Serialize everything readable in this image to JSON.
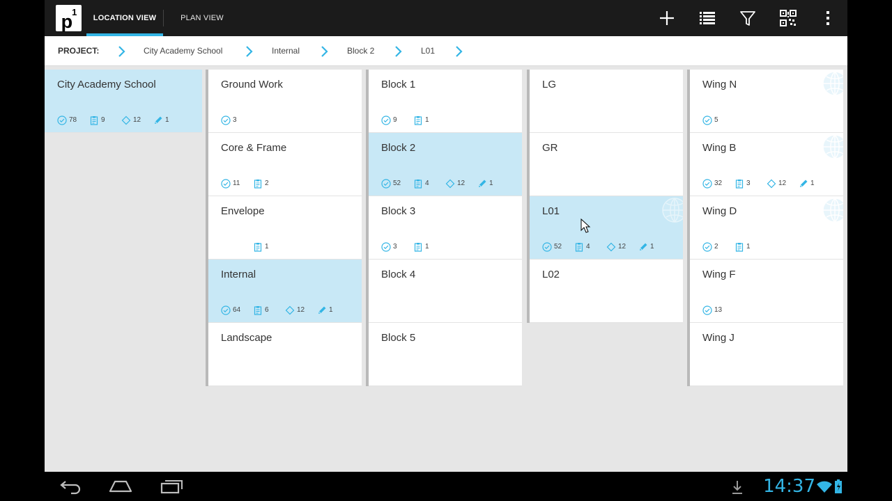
{
  "app": {
    "logo_text": "p",
    "logo_sup": "1",
    "tabs": [
      {
        "label": "LOCATION VIEW"
      },
      {
        "label": "PLAN VIEW"
      }
    ],
    "actions": [
      "add-icon",
      "list-icon",
      "filter-icon",
      "qr-code-icon",
      "overflow-menu-icon"
    ]
  },
  "breadcrumb": {
    "label": "PROJECT:",
    "items": [
      "City Academy School",
      "Internal",
      "Block 2",
      "L01"
    ]
  },
  "columns": [
    {
      "cards": [
        {
          "name": "City Academy School",
          "selected": true,
          "globe": false,
          "stats": [
            {
              "icon": "check",
              "value": "78"
            },
            {
              "icon": "clipboard",
              "value": "9"
            },
            {
              "icon": "diamond",
              "value": "12"
            },
            {
              "icon": "pencil",
              "value": "1"
            }
          ]
        }
      ]
    },
    {
      "cards": [
        {
          "name": "Ground Work",
          "selected": false,
          "globe": false,
          "stats": [
            {
              "icon": "check",
              "value": "3"
            }
          ]
        },
        {
          "name": "Core & Frame",
          "selected": false,
          "globe": false,
          "stats": [
            {
              "icon": "check",
              "value": "11"
            },
            {
              "icon": "clipboard",
              "value": "2"
            }
          ]
        },
        {
          "name": "Envelope",
          "selected": false,
          "globe": false,
          "stats": [
            {
              "icon": "clipboard",
              "value": "1",
              "slot": 1
            }
          ]
        },
        {
          "name": "Internal",
          "selected": true,
          "globe": false,
          "stats": [
            {
              "icon": "check",
              "value": "64"
            },
            {
              "icon": "clipboard",
              "value": "6"
            },
            {
              "icon": "diamond",
              "value": "12"
            },
            {
              "icon": "pencil",
              "value": "1"
            }
          ]
        },
        {
          "name": "Landscape",
          "selected": false,
          "globe": false,
          "stats": []
        }
      ]
    },
    {
      "cards": [
        {
          "name": "Block 1",
          "selected": false,
          "globe": false,
          "stats": [
            {
              "icon": "check",
              "value": "9"
            },
            {
              "icon": "clipboard",
              "value": "1"
            }
          ]
        },
        {
          "name": "Block 2",
          "selected": true,
          "globe": false,
          "stats": [
            {
              "icon": "check",
              "value": "52"
            },
            {
              "icon": "clipboard",
              "value": "4"
            },
            {
              "icon": "diamond",
              "value": "12"
            },
            {
              "icon": "pencil",
              "value": "1"
            }
          ]
        },
        {
          "name": "Block 3",
          "selected": false,
          "globe": false,
          "stats": [
            {
              "icon": "check",
              "value": "3"
            },
            {
              "icon": "clipboard",
              "value": "1"
            }
          ]
        },
        {
          "name": "Block 4",
          "selected": false,
          "globe": false,
          "stats": []
        },
        {
          "name": "Block 5",
          "selected": false,
          "globe": false,
          "stats": []
        }
      ]
    },
    {
      "cards": [
        {
          "name": "LG",
          "selected": false,
          "globe": false,
          "stats": []
        },
        {
          "name": "GR",
          "selected": false,
          "globe": false,
          "stats": []
        },
        {
          "name": "L01",
          "selected": true,
          "globe": true,
          "stats": [
            {
              "icon": "check",
              "value": "52"
            },
            {
              "icon": "clipboard",
              "value": "4"
            },
            {
              "icon": "diamond",
              "value": "12"
            },
            {
              "icon": "pencil",
              "value": "1"
            }
          ]
        },
        {
          "name": "L02",
          "selected": false,
          "globe": false,
          "stats": []
        }
      ]
    },
    {
      "cards": [
        {
          "name": "Wing N",
          "selected": false,
          "globe": true,
          "stats": [
            {
              "icon": "check",
              "value": "5"
            }
          ]
        },
        {
          "name": "Wing B",
          "selected": false,
          "globe": true,
          "stats": [
            {
              "icon": "check",
              "value": "32"
            },
            {
              "icon": "clipboard",
              "value": "3"
            },
            {
              "icon": "diamond",
              "value": "12"
            },
            {
              "icon": "pencil",
              "value": "1"
            }
          ]
        },
        {
          "name": "Wing D",
          "selected": false,
          "globe": true,
          "stats": [
            {
              "icon": "check",
              "value": "2"
            },
            {
              "icon": "clipboard",
              "value": "1"
            }
          ]
        },
        {
          "name": "Wing F",
          "selected": false,
          "globe": false,
          "stats": [
            {
              "icon": "check",
              "value": "13"
            }
          ]
        },
        {
          "name": "Wing J",
          "selected": false,
          "globe": false,
          "stats": []
        }
      ]
    }
  ],
  "status_bar": {
    "clock": "14:37"
  },
  "colors": {
    "accent": "#33b5e5",
    "selected_card": "#c8e8f6",
    "action_bar": "#1b1b1b",
    "background": "#e6e6e6"
  }
}
